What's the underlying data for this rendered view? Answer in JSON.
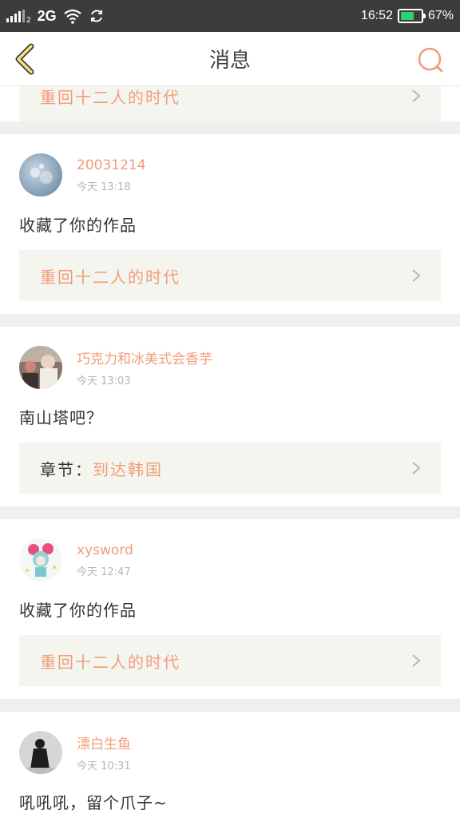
{
  "status_bar": {
    "network": "2G",
    "sim_index": "2",
    "time": "16:52",
    "battery": "67%",
    "battery_level": 0.67,
    "battery_color": "#2bd36e"
  },
  "header": {
    "title": "消息",
    "back_icon": "chevron-left-icon",
    "search_icon": "search-icon",
    "accent_color": "#f19d78"
  },
  "partial_item": {
    "ref_text": "重回十二人的时代"
  },
  "messages": [
    {
      "name": "20031214",
      "time": "今天 13:18",
      "body": "收藏了你的作品",
      "ref_prefix": "",
      "ref_text": "重回十二人的时代"
    },
    {
      "name": "巧克力和冰美式会香芋",
      "time": "今天 13:03",
      "body": "南山塔吧？",
      "ref_prefix": "章节：",
      "ref_text": "到达韩国"
    },
    {
      "name": "xysword",
      "time": "今天 12:47",
      "body": "收藏了你的作品",
      "ref_prefix": "",
      "ref_text": "重回十二人的时代"
    },
    {
      "name": "漂白生鱼",
      "time": "今天 10:31",
      "body": "吼吼吼，留个爪子~",
      "ref_prefix": "",
      "ref_text": ""
    }
  ]
}
